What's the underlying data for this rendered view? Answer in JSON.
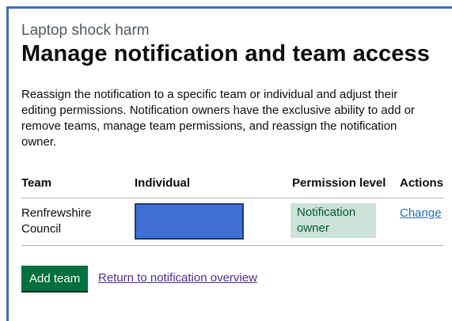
{
  "page": {
    "caption": "Laptop shock harm",
    "heading": "Manage notification and team access",
    "intro": "Reassign the notification to a specific team or individual and adjust their editing permissions. Notification owners have the exclusive ability to add or remove teams, manage team permissions, and reassign the notification owner."
  },
  "table": {
    "headers": [
      "Team",
      "Individual",
      "Permission level",
      "Actions"
    ],
    "rows": [
      {
        "team": "Renfrewshire Council",
        "permission": "Notification owner",
        "action": "Change"
      }
    ]
  },
  "actions": {
    "add_team_label": "Add team",
    "return_link_label": "Return to notification overview"
  },
  "colors": {
    "primary_button": "#00703c",
    "link": "#1d70b8",
    "visited_link": "#4c2c92",
    "tag_background": "#cce2d8",
    "redaction": "#3f6fd4"
  }
}
